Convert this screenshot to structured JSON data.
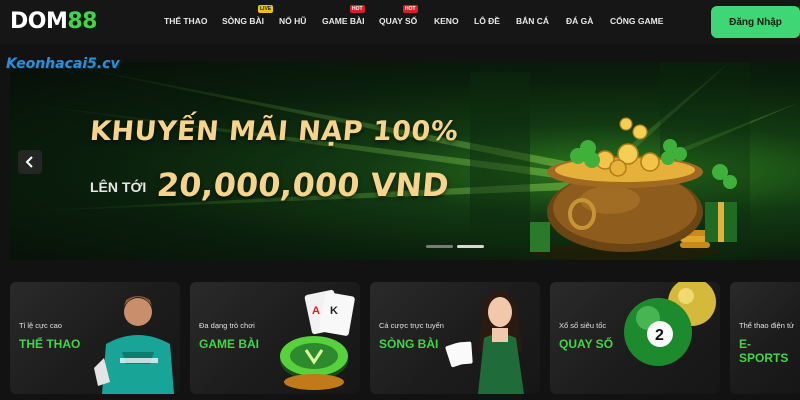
{
  "brand": {
    "logo_part1": "DOM",
    "logo_part2": "88",
    "accent": "#3fd64a"
  },
  "nav": {
    "items": [
      {
        "label": "THỂ THAO",
        "badge": ""
      },
      {
        "label": "SÒNG BÀI",
        "badge": "LIVE"
      },
      {
        "label": "NỔ HŨ",
        "badge": ""
      },
      {
        "label": "GAME BÀI",
        "badge": "HOT"
      },
      {
        "label": "QUAY SỐ",
        "badge": "HOT"
      },
      {
        "label": "KENO",
        "badge": ""
      },
      {
        "label": "LÔ ĐỀ",
        "badge": ""
      },
      {
        "label": "BẮN CÁ",
        "badge": ""
      },
      {
        "label": "ĐÁ GÀ",
        "badge": ""
      },
      {
        "label": "CỔNG GAME",
        "badge": ""
      }
    ],
    "login_label": "Đăng Nhập",
    "login_color": "#3fd676"
  },
  "watermark": "Keonhacai5.cv",
  "banner": {
    "title": "KHUYẾN MÃI NẠP 100%",
    "sub": "LÊN TỚI",
    "amount": "20,000,000 VND",
    "slide_count": 2,
    "active_slide": 1
  },
  "categories": [
    {
      "sub": "Tỉ lệ cực cao",
      "title": "THỂ THAO",
      "icon": "football-player-icon"
    },
    {
      "sub": "Đa dạng trò chơi",
      "title": "GAME BÀI",
      "icon": "playing-cards-icon"
    },
    {
      "sub": "Cá cược trực tuyến",
      "title": "SÒNG BÀI",
      "icon": "casino-dealer-icon"
    },
    {
      "sub": "Xổ số siêu tốc",
      "title": "QUAY SỐ",
      "icon": "lottery-balls-icon"
    },
    {
      "sub": "Thể thao điện tử",
      "title": "E-SPORTS",
      "icon": "esports-icon"
    }
  ],
  "lottery_ball_numbers": [
    "2"
  ],
  "card_letters": [
    "A",
    "K"
  ]
}
